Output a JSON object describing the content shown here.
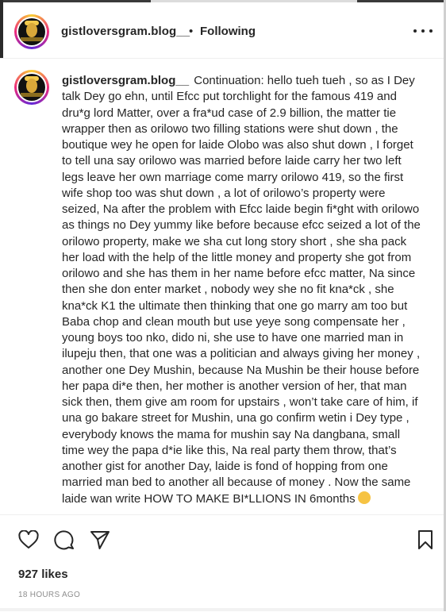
{
  "header": {
    "username": "gistloversgram.blog__",
    "separator": "•",
    "follow_state": "Following",
    "more_icon": "more-horizontal-icon"
  },
  "caption": {
    "username": "gistloversgram.blog__",
    "text": "Continuation: hello tueh tueh , so as I Dey talk Dey go ehn, until Efcc put torchlight for the famous 419 and dru*g lord Matter, over a fra*ud case of 2.9 billion, the matter tie wrapper then as orilowo two filling stations were shut down , the boutique wey he open for laide Olobo was also shut down , I forget to tell una say orilowo was married before laide carry her two left legs leave her own marriage come marry orilowo 419, so the first wife shop too was shut down , a lot of orilowo’s property were seized, Na after the problem with Efcc laide begin fi*ght with orilowo as things no Dey yummy like before because efcc seized a lot of the orilowo property, make we sha cut long story short , she sha pack her load with the help of the little money and property she got from orilowo and she has them in her name before efcc matter, Na since then she don enter market , nobody wey she no fit kna*ck , she kna*ck K1 the ultimate then thinking that one go marry am too but Baba chop and clean mouth but use yeye song compensate her , young boys too nko, dido ni, she use to have one married man in ilupeju then, that one was a politician and always giving her money , another one Dey Mushin, because Na Mushin be their house before her papa di*e then, her mother is another version of her, that man sick then, them give am room for upstairs , won’t take care of him, if una go bakare street for Mushin, una go confirm wetin i Dey type , everybody knows the mama for mushin say Na dangbana, small time wey the papa d*ie like this, Na real party them throw, that’s another gist for another Day, laide is fond of hopping from one married man bed to another all because of money . Now the same laide wan write HOW TO MAKE BI*LLIONS IN 6months"
  },
  "actions": {
    "like_icon": "heart-icon",
    "comment_icon": "comment-bubble-icon",
    "share_icon": "paper-plane-icon",
    "save_icon": "bookmark-icon"
  },
  "stats": {
    "likes": "927 likes",
    "timestamp": "18 HOURS AGO"
  },
  "colors": {
    "text": "#262626",
    "muted": "#8e8e8e",
    "divider": "#efefef"
  }
}
